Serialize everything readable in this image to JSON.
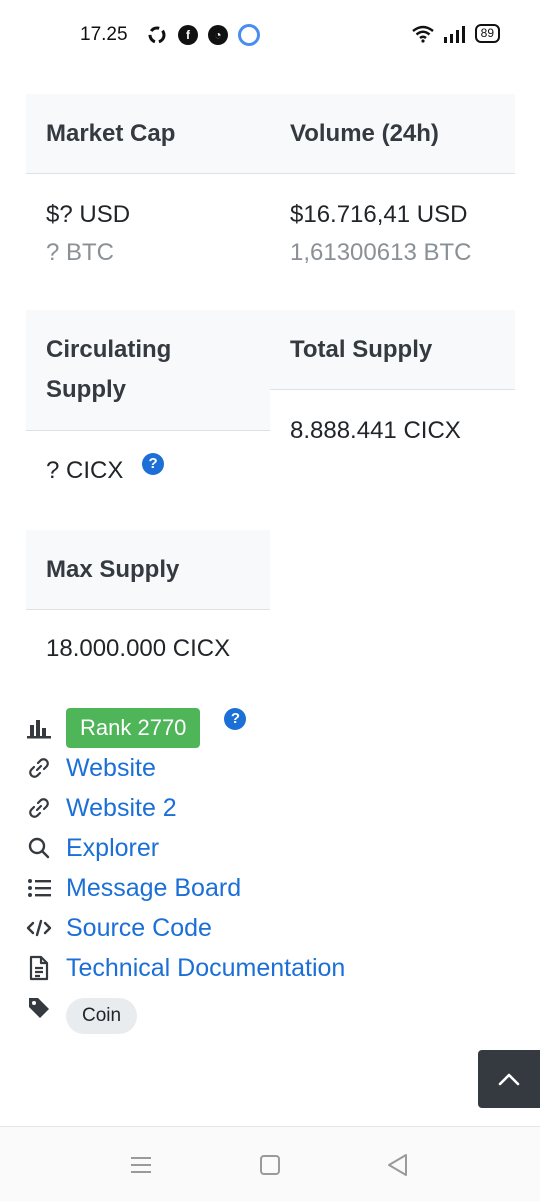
{
  "status_bar": {
    "time": "17.25",
    "battery": "89",
    "apps": [
      "sync-icon",
      "facebook-icon",
      "messenger-icon",
      "app-dot-icon"
    ]
  },
  "stats": {
    "market_cap": {
      "label": "Market Cap",
      "usd": "$? USD",
      "btc": "? BTC"
    },
    "volume": {
      "label": "Volume (24h)",
      "usd": "$16.716,41 USD",
      "btc": "1,61300613 BTC"
    },
    "circulating": {
      "label": "Circulating Supply",
      "value": "? CICX",
      "help_icon": "?"
    },
    "total": {
      "label": "Total Supply",
      "value": "8.888.441 CICX"
    },
    "max": {
      "label": "Max Supply",
      "value": "18.000.000 CICX"
    }
  },
  "links": {
    "rank": "Rank 2770",
    "rank_help": "?",
    "website": "Website",
    "website2": "Website 2",
    "explorer": "Explorer",
    "message_board": "Message Board",
    "source_code": "Source Code",
    "tech_docs": "Technical Documentation",
    "tag": "Coin"
  },
  "colors": {
    "link": "#1b6fd6",
    "rank_badge": "#4fb559",
    "header_bg": "#f8f9fa",
    "scroll_top_bg": "#343a40"
  }
}
